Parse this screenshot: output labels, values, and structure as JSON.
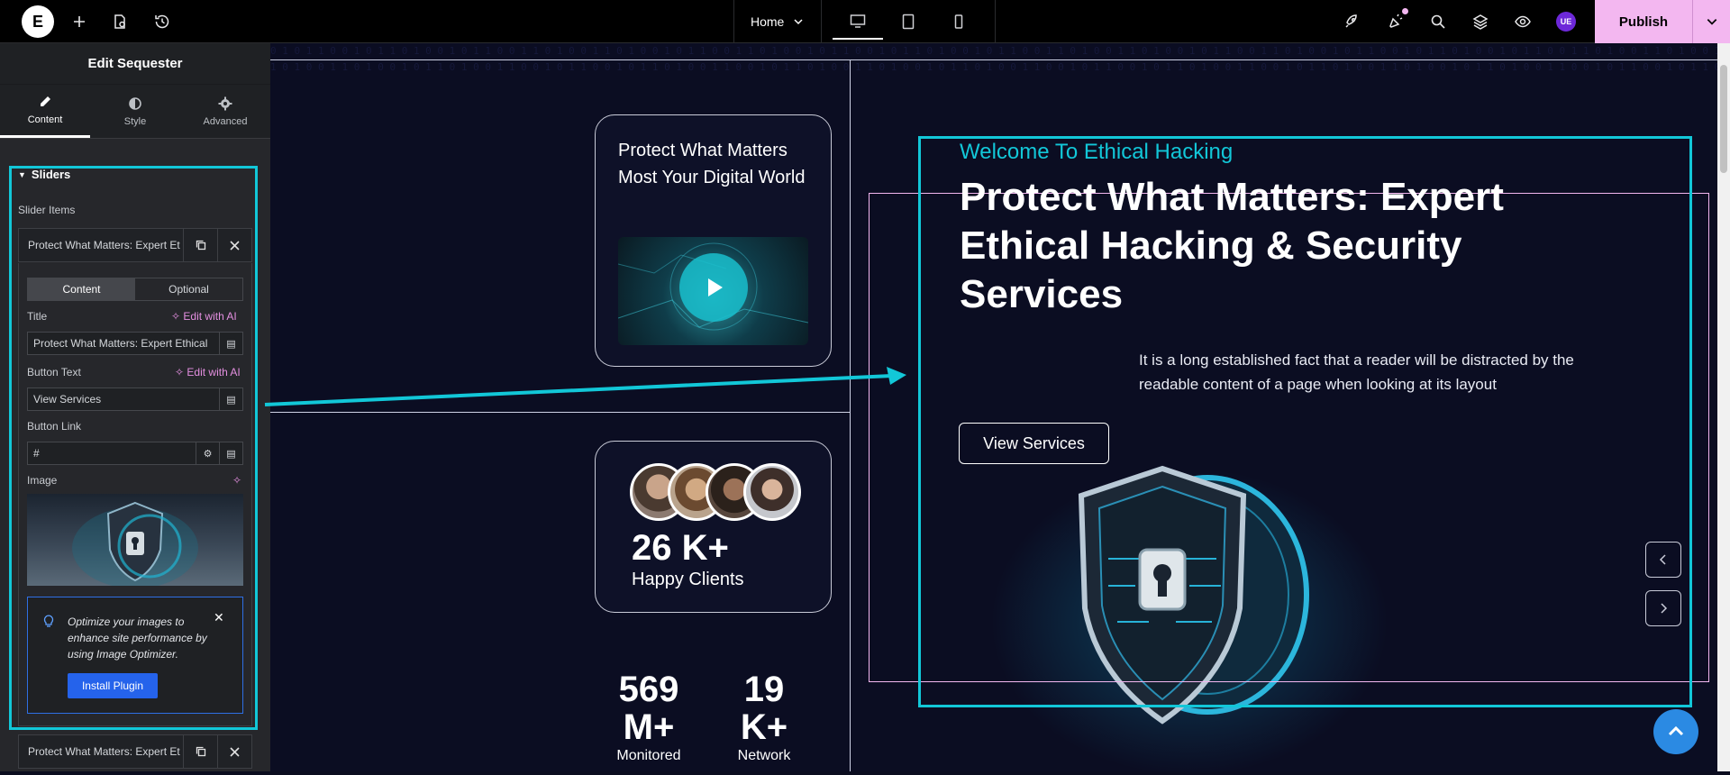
{
  "topbar": {
    "logo_text": "E",
    "page_name": "Home",
    "publish_label": "Publish",
    "user_initials": "UE"
  },
  "panel": {
    "heading": "Edit Sequester",
    "tabs": [
      "Content",
      "Style",
      "Advanced"
    ],
    "section_title": "Sliders",
    "slider_items_label": "Slider Items",
    "item_title": "Protect What Matters: Expert Et",
    "item2_title": "Protect What Matters: Expert Et",
    "inner_tabs": [
      "Content",
      "Optional"
    ],
    "title_label": "Title",
    "edit_ai": "Edit with AI",
    "title_value": "Protect What Matters: Expert Ethical",
    "button_text_label": "Button Text",
    "button_text_value": "View Services",
    "button_link_label": "Button Link",
    "button_link_value": "#",
    "image_label": "Image",
    "notice_text": "Optimize your images to enhance site performance by using Image Optimizer.",
    "notice_button": "Install Plugin"
  },
  "canvas": {
    "card1_title": "Protect What Matters Most Your Digital World",
    "stat_clients_num": "26 K+",
    "stat_clients_label": "Happy Clients",
    "stat_monitored_num": "569 M+",
    "stat_monitored_label": "Monitored",
    "stat_network_num": "19 K+",
    "stat_network_label": "Network",
    "hero_kicker": "Welcome To Ethical Hacking",
    "hero_title": "Protect What Matters: Expert Ethical Hacking & Security Services",
    "hero_desc": "It is a long established fact that a reader will be distracted by the readable content of a page when looking at its layout",
    "hero_button": "View Services"
  },
  "colors": {
    "accent_cyan": "#12c7d8",
    "accent_pink": "#f3b7f0",
    "canvas_bg": "#0b0d22",
    "panel_bg": "#26272b",
    "install_button": "#2563eb"
  }
}
